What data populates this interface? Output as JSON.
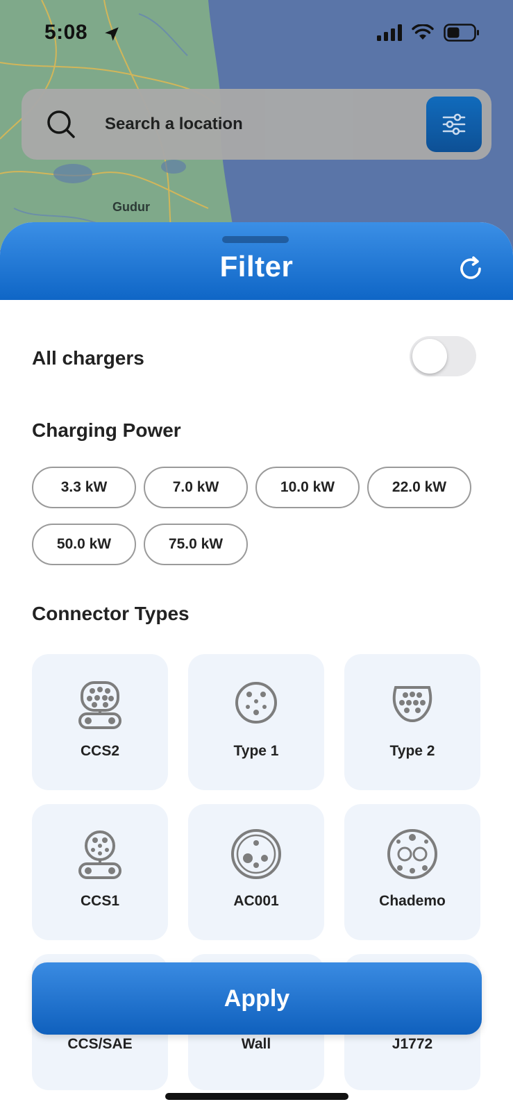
{
  "status_bar": {
    "time": "5:08"
  },
  "map": {
    "place_label": "Gudur"
  },
  "search": {
    "placeholder": "Search a location"
  },
  "filter_sheet": {
    "title": "Filter",
    "all_chargers": {
      "label": "All chargers",
      "enabled": false
    },
    "charging_power": {
      "label": "Charging Power",
      "options": [
        "3.3 kW",
        "7.0 kW",
        "10.0 kW",
        "22.0 kW",
        "50.0 kW",
        "75.0 kW"
      ]
    },
    "connector_types": {
      "label": "Connector Types",
      "items": [
        {
          "label": "CCS2",
          "icon": "ccs2-connector-icon"
        },
        {
          "label": "Type 1",
          "icon": "type1-connector-icon"
        },
        {
          "label": "Type 2",
          "icon": "type2-connector-icon"
        },
        {
          "label": "CCS1",
          "icon": "ccs1-connector-icon"
        },
        {
          "label": "AC001",
          "icon": "ac001-connector-icon"
        },
        {
          "label": "Chademo",
          "icon": "chademo-connector-icon"
        },
        {
          "label": "CCS/SAE",
          "icon": "ccs-sae-connector-icon"
        },
        {
          "label": "Wall",
          "icon": "wall-connector-icon"
        },
        {
          "label": "J1772",
          "icon": "j1772-connector-icon"
        }
      ]
    },
    "apply_label": "Apply"
  },
  "colors": {
    "accent": "#1a72d0",
    "card_bg": "#eff4fb",
    "icon_gray": "#7d7d7d"
  }
}
